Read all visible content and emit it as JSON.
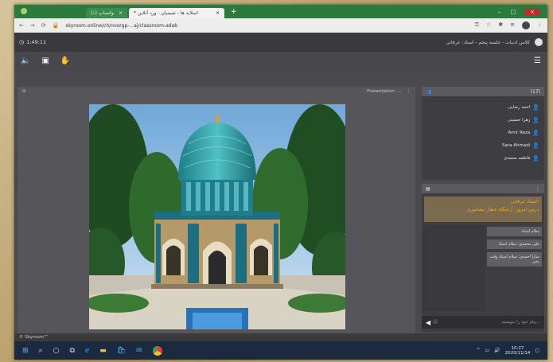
{
  "browser": {
    "tabs": [
      {
        "label": "(۱) واتساپ",
        "active": false
      },
      {
        "label": "* اسلاید ها - شیمیان - ورد آنلاین",
        "active": true
      }
    ],
    "url": "skyroom.online/ch/noorgp-...aj/classroom-adab",
    "new_tab": "+"
  },
  "app": {
    "timer": "1:49:11",
    "room_title": "کلاس ادبیات - جلسه پنجم - استاد: عرفانی",
    "content_label": "Presentation: ...",
    "footer": "© Skyroom™"
  },
  "participants": {
    "count": "(17)",
    "list": [
      "احمد رضایی",
      "زهرا حسینی",
      "Amir Reza",
      "Sara Ahmadi",
      "فاطمه محمدی"
    ]
  },
  "chat": {
    "banner_line1": "استاد عرفانی:",
    "banner_line2": "درس امروز: آرامگاه عطار نیشابوری",
    "messages": [
      "سلام استاد",
      "علی محمدی: سلام استاد",
      "سارا احمدی: سلام استاد وقت بخیر"
    ],
    "placeholder": "پیام خود را بنویسید..."
  },
  "taskbar": {
    "time": "10:27",
    "date": "2020/11/14"
  },
  "icons": {
    "speaker": "speaker-icon",
    "screen": "screen-icon",
    "hand": "raise-hand-icon",
    "menu": "hamburger-menu-icon"
  },
  "colors": {
    "app_bg": "#4a4a4e",
    "banner_text": "#f7a72a",
    "user_icon": "#e8c84a"
  }
}
